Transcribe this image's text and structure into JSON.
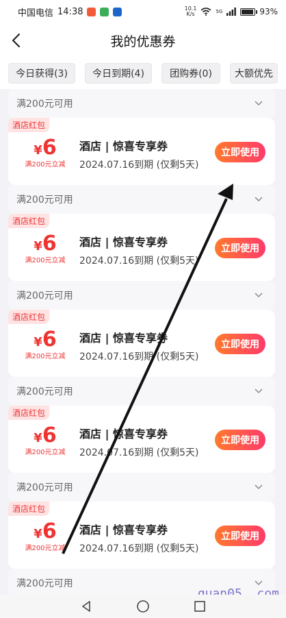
{
  "status": {
    "carrier": "中国电信",
    "time": "14:38",
    "speed_top": "10.1",
    "speed_bottom": "K/s",
    "signal_label": "5G",
    "battery": "93%"
  },
  "nav": {
    "title": "我的优惠券"
  },
  "filters": [
    {
      "label": "今日获得(3)"
    },
    {
      "label": "今日到期(4)"
    },
    {
      "label": "团购券(0)"
    },
    {
      "label": "大额优先"
    }
  ],
  "limit_text": "满200元可用",
  "coupons": [
    {
      "tag": "酒店红包",
      "yen": "¥",
      "amount": "6",
      "condition": "满200元立减",
      "title": "酒店 | 惊喜专享券",
      "expire": "2024.07.16到期 (仅剩5天)",
      "button": "立即使用"
    },
    {
      "tag": "酒店红包",
      "yen": "¥",
      "amount": "6",
      "condition": "满200元立减",
      "title": "酒店 | 惊喜专享券",
      "expire": "2024.07.16到期 (仅剩5天)",
      "button": "立即使用"
    },
    {
      "tag": "酒店红包",
      "yen": "¥",
      "amount": "6",
      "condition": "满200元立减",
      "title": "酒店 | 惊喜专享券",
      "expire": "2024.07.16到期 (仅剩5天)",
      "button": "立即使用"
    },
    {
      "tag": "酒店红包",
      "yen": "¥",
      "amount": "6",
      "condition": "满200元立减",
      "title": "酒店 | 惊喜专享券",
      "expire": "2024.07.16到期 (仅剩5天)",
      "button": "立即使用"
    },
    {
      "tag": "酒店红包",
      "yen": "¥",
      "amount": "6",
      "condition": "满200元立减",
      "title": "酒店 | 惊喜专享券",
      "expire": "2024.07.16到期 (仅剩5天)",
      "button": "立即使用"
    }
  ],
  "watermark": "quan05. com",
  "colors": {
    "accent": "#ff4d4f",
    "button_start": "#ff7a2d",
    "button_end": "#ff3a6b"
  },
  "icons": {
    "back": "chevron-left-icon",
    "expand": "chevron-down-icon"
  }
}
